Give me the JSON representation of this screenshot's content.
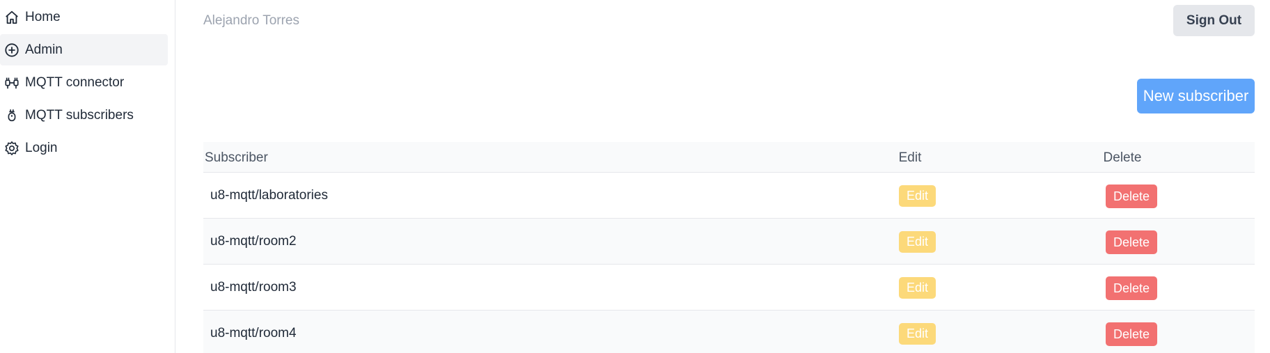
{
  "sidebar": {
    "items": [
      {
        "label": "Home",
        "icon": "home-icon",
        "active": false
      },
      {
        "label": "Admin",
        "icon": "plus-circle-icon",
        "active": true
      },
      {
        "label": "MQTT connector",
        "icon": "connector-icon",
        "active": false
      },
      {
        "label": "MQTT subscribers",
        "icon": "plug-icon",
        "active": false
      },
      {
        "label": "Login",
        "icon": "gear-icon",
        "active": false
      }
    ]
  },
  "header": {
    "user_name": "Alejandro Torres",
    "sign_out_label": "Sign Out"
  },
  "actions": {
    "new_subscriber_label": "New subscriber"
  },
  "table": {
    "columns": [
      "Subscriber",
      "Edit",
      "Delete"
    ],
    "rows": [
      {
        "subscriber": "u8-mqtt/laboratories",
        "edit": "Edit",
        "delete": "Delete"
      },
      {
        "subscriber": "u8-mqtt/room2",
        "edit": "Edit",
        "delete": "Delete"
      },
      {
        "subscriber": "u8-mqtt/room3",
        "edit": "Edit",
        "delete": "Delete"
      },
      {
        "subscriber": "u8-mqtt/room4",
        "edit": "Edit",
        "delete": "Delete"
      }
    ]
  },
  "colors": {
    "primary": "#60a5fa",
    "edit": "#fcd97a",
    "delete": "#f27171",
    "muted": "#9ca3af"
  }
}
